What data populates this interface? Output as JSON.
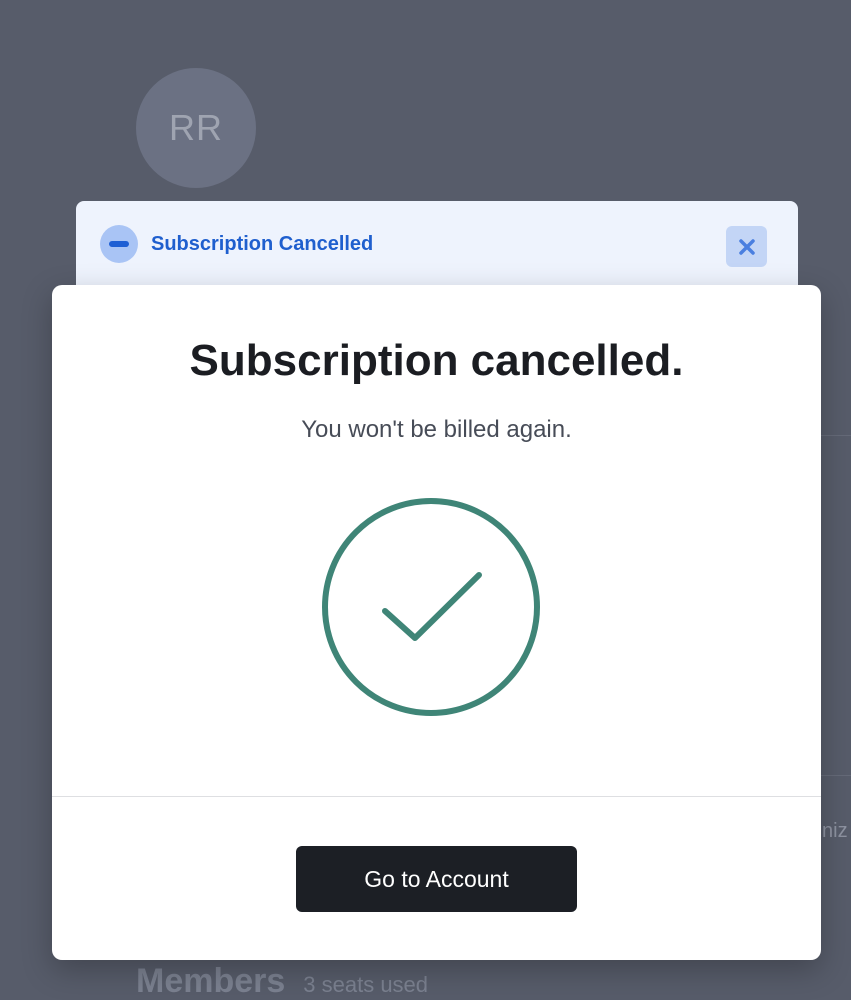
{
  "background": {
    "avatar_initials": "RR",
    "cut_text": "niz",
    "members_title": "Members",
    "members_seats": "3 seats used"
  },
  "toast": {
    "icon": "minus-circle-icon",
    "title": "Subscription Cancelled",
    "close_icon": "close-icon"
  },
  "modal": {
    "title": "Subscription cancelled.",
    "subtitle": "You won't be billed again.",
    "status_icon": "check-circle-icon",
    "primary_button_label": "Go to Account"
  },
  "colors": {
    "overlay": "#575c6a",
    "toast_background": "#eef3fd",
    "toast_accent": "#1f5fce",
    "success": "#3f8577",
    "button_background": "#1c1f25"
  }
}
